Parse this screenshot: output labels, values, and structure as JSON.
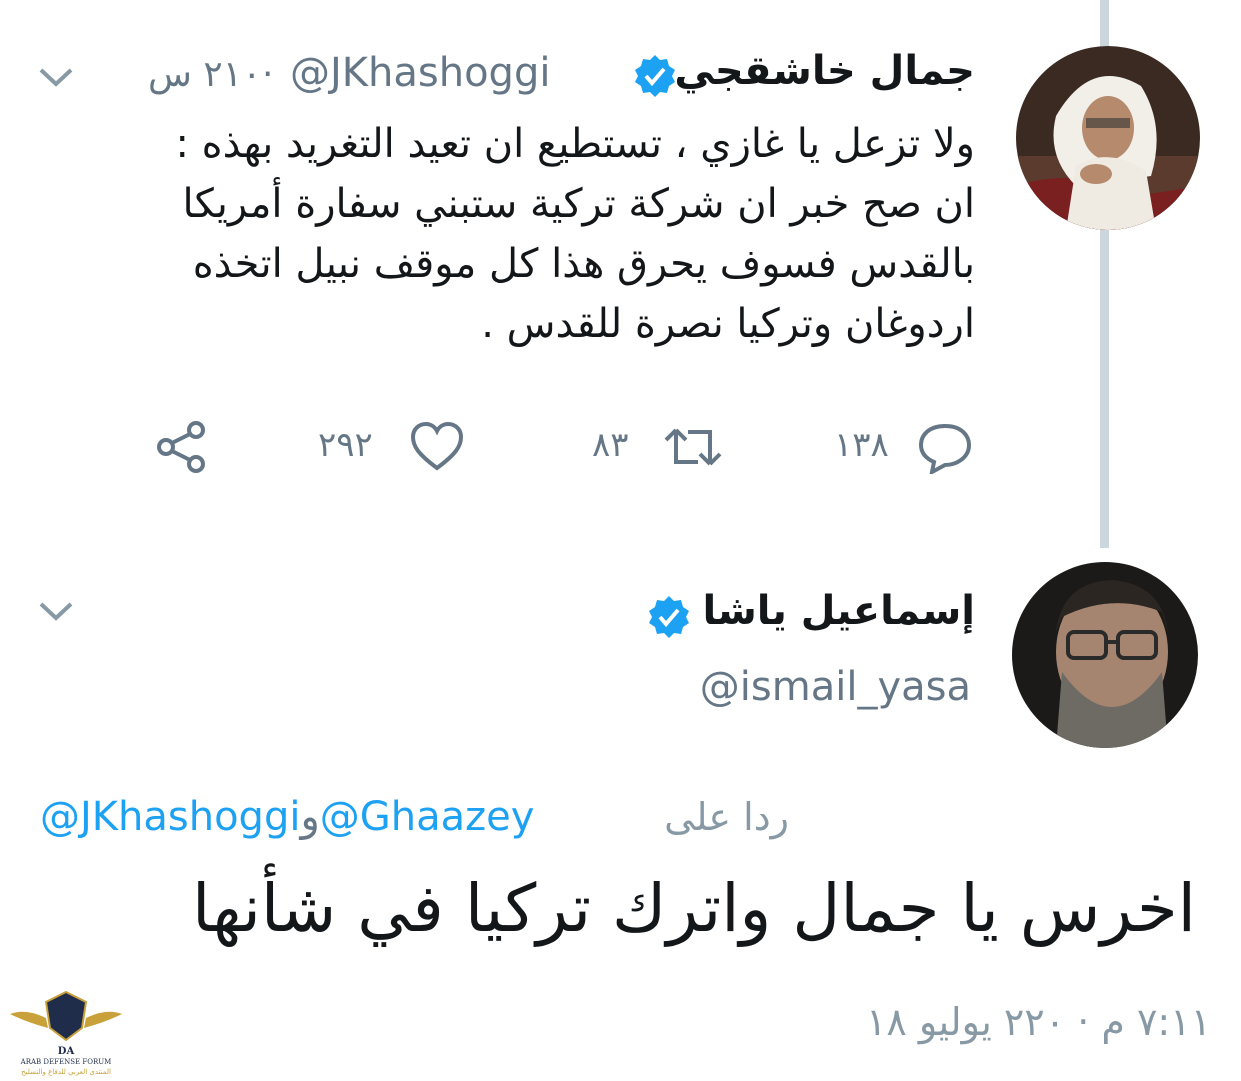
{
  "colors": {
    "accent": "#1da1f2",
    "muted": "#657786",
    "thread": "#ccd6dd",
    "text": "#14171a"
  },
  "tweet1": {
    "author": {
      "name": "جمال خاشقجي",
      "handle": "@JKhashoggi",
      "verified": true
    },
    "time": "٢١٠ س",
    "separator": "·",
    "lines": [
      "ولا تزعل يا غازي ، تستطيع ان تعيد التغريد بهذه :",
      "ان صح خبر ان شركة تركية ستبني سفارة أمريكا",
      "بالقدس فسوف يحرق هذا كل موقف نبيل اتخذه",
      "اردوغان وتركيا نصرة للقدس ."
    ],
    "actions": {
      "reply_count": "١٣٨",
      "retweet_count": "٨٣",
      "like_count": "٢٩٢",
      "reply_icon": "reply-icon",
      "retweet_icon": "retweet-icon",
      "like_icon": "heart-icon",
      "share_icon": "share-icon"
    }
  },
  "tweet2": {
    "author": {
      "name": "إسماعيل ياشا",
      "handle": "@ismail_yasa",
      "verified": true
    },
    "reply_prefix": "ردا على",
    "reply_mention_1": "@JKhashoggi",
    "reply_conj": "و",
    "reply_mention_2": "@Ghaazey",
    "text": "اخرس يا جمال واترك تركيا في شأنها",
    "timestamp": "٧:١١ م · ٢٢٠ يوليو ١٨"
  },
  "watermark": {
    "abbr": "DA",
    "name_en": "ARAB DEFENSE FORUM",
    "name_ar": "المنتدى العربي للدفاع والتسليح"
  }
}
